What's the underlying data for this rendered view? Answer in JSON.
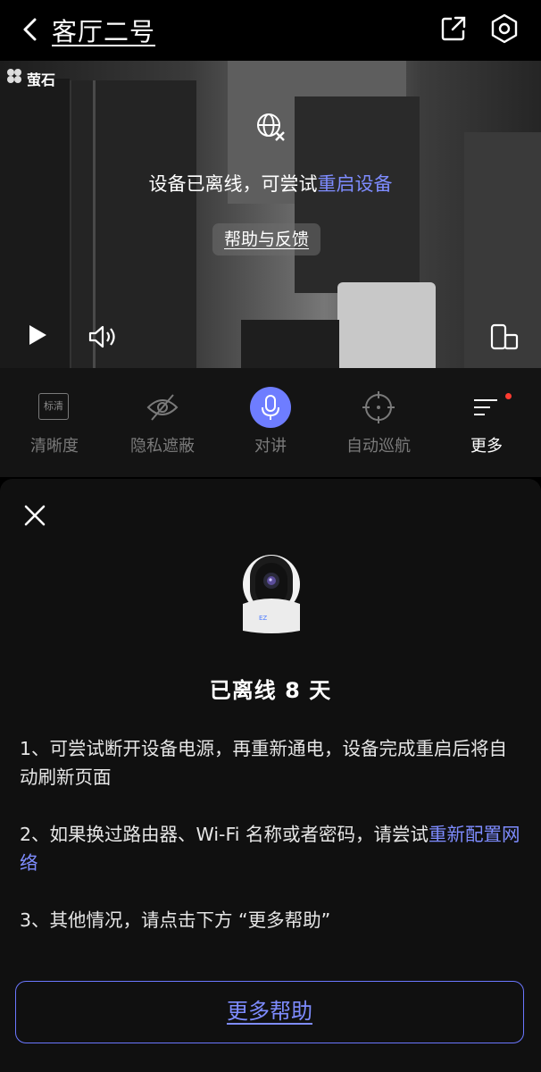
{
  "header": {
    "back_icon": "chevron-left-icon",
    "title": "客厅二号",
    "share_icon": "share-external-icon",
    "settings_icon": "hexagon-gear-icon"
  },
  "video": {
    "brand": "萤石",
    "offline_icon": "globe-offline-icon",
    "offline_text": "设备已离线，可尝试",
    "offline_link": "重启设备",
    "help_button": "帮助与反馈",
    "play_icon": "play-icon",
    "sound_icon": "speaker-icon",
    "rotate_icon": "screen-rotate-icon"
  },
  "toolbar": {
    "items": [
      {
        "label": "清晰度",
        "badge": "标清",
        "icon": "definition-icon"
      },
      {
        "label": "隐私遮蔽",
        "icon": "eye-slash-icon"
      },
      {
        "label": "对讲",
        "icon": "microphone-icon"
      },
      {
        "label": "自动巡航",
        "icon": "crosshair-icon"
      },
      {
        "label": "更多",
        "icon": "menu-more-icon"
      }
    ],
    "accent": "#6e7dff",
    "notification_color": "#ff3b30"
  },
  "sheet": {
    "close_icon": "close-icon",
    "camera_icon": "camera-device-icon",
    "status": "已离线 8 天",
    "tips": [
      {
        "text": "1、可尝试断开设备电源，再重新通电，设备完成重启后将自动刷新页面",
        "link": ""
      },
      {
        "text": "2、如果换过路由器、Wi-Fi 名称或者密码，请尝试",
        "link": "重新配置网络"
      },
      {
        "text": "3、其他情况，请点击下方 “更多帮助”",
        "link": ""
      }
    ],
    "more_help_button": "更多帮助",
    "link_color": "#7e8cff"
  }
}
